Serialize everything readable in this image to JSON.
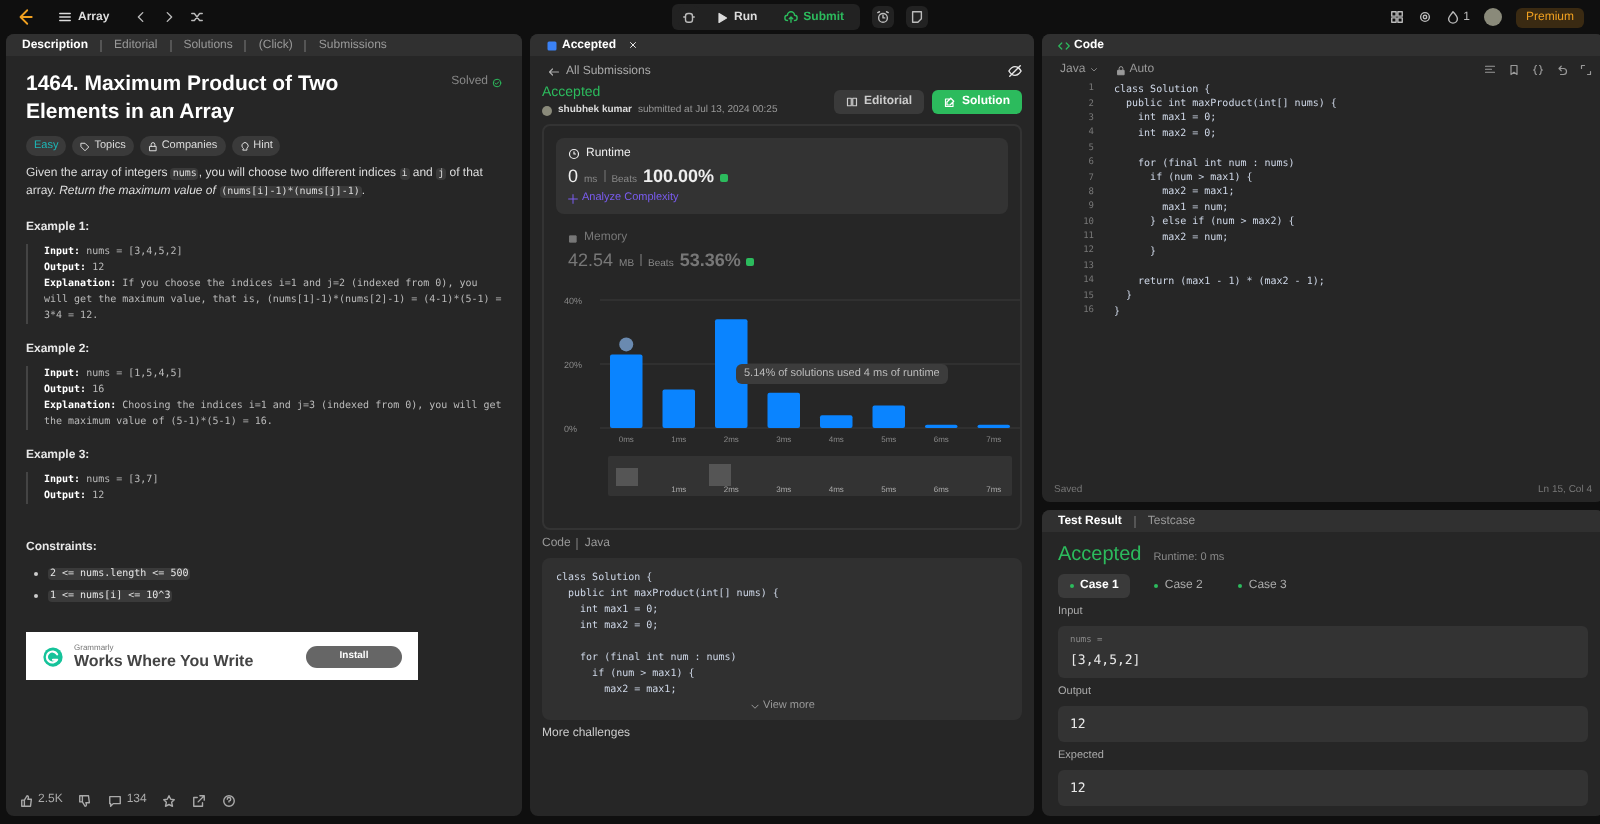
{
  "top_bar": {
    "list_label": "Array",
    "run": "Run",
    "submit": "Submit",
    "streak": "1",
    "premium": "Premium"
  },
  "description_panel": {
    "tabs": [
      {
        "label": "Description",
        "selected": true
      },
      {
        "label": "Editorial",
        "selected": false
      },
      {
        "label": "Solutions",
        "selected": false
      },
      {
        "label": "(Click)",
        "selected": false
      },
      {
        "label": "Submissions",
        "selected": false
      }
    ],
    "title": "1464. Maximum Product of Two Elements in an Array",
    "solved": "Solved",
    "tags": [
      {
        "kind": "difficulty",
        "label": "Easy"
      },
      {
        "kind": "topics",
        "label": "Topics"
      },
      {
        "kind": "companies",
        "label": "Companies"
      },
      {
        "kind": "hint",
        "label": "Hint"
      }
    ],
    "statement": [
      {
        "kind": "text",
        "text": "Given the array of integers "
      },
      {
        "kind": "code",
        "text": "nums"
      },
      {
        "kind": "text",
        "text": ", you will choose two different indices "
      },
      {
        "kind": "code",
        "text": "i"
      },
      {
        "kind": "text",
        "text": " and "
      },
      {
        "kind": "code",
        "text": "j"
      },
      {
        "kind": "text",
        "text": " of that array. "
      },
      {
        "kind": "italic",
        "text": "Return the maximum value of "
      },
      {
        "kind": "code",
        "text": "(nums[i]-1)*(nums[j]-1)"
      },
      {
        "kind": "text",
        "text": "."
      }
    ],
    "examples": [
      {
        "title": "Example 1:",
        "lines": [
          {
            "label": "Input:",
            "text": "nums = [3,4,5,2]"
          },
          {
            "label": "Output:",
            "text": "12"
          },
          {
            "label": "Explanation:",
            "text": "If you choose the indices i=1 and j=2 (indexed from 0), you will get the maximum value, that is, (nums[1]-1)*(nums[2]-1) = (4-1)*(5-1) = 3*4 = 12."
          }
        ]
      },
      {
        "title": "Example 2:",
        "lines": [
          {
            "label": "Input:",
            "text": "nums = [1,5,4,5]"
          },
          {
            "label": "Output:",
            "text": "16"
          },
          {
            "label": "Explanation:",
            "text": "Choosing the indices i=1 and j=3 (indexed from 0), you will get the maximum value of (5-1)*(5-1) = 16."
          }
        ]
      },
      {
        "title": "Example 3:",
        "lines": [
          {
            "label": "Input:",
            "text": "nums = [3,7]"
          },
          {
            "label": "Output:",
            "text": "12"
          }
        ]
      }
    ],
    "constraints_title": "Constraints:",
    "constraints": [
      "2 <= nums.length <= 500",
      "1 <= nums[i] <= 10^3"
    ],
    "ad": {
      "brand": "Grammarly",
      "headline": "Works Where You Write",
      "button": "Install"
    },
    "footer": {
      "likes": "2.5K",
      "comments": "134"
    }
  },
  "submission_panel": {
    "tab": "Accepted",
    "back": "All Submissions",
    "status": "Accepted",
    "user": "shubhek kumar",
    "submitted": "submitted at Jul 13, 2024 00:25",
    "editorial": "Editorial",
    "solution": "Solution",
    "metrics": [
      {
        "kind": "runtime",
        "label": "Runtime",
        "value": "0",
        "unit": "ms",
        "beats_label": "Beats",
        "beats": "100.00%",
        "selected": true,
        "link": "Analyze Complexity"
      },
      {
        "kind": "memory",
        "label": "Memory",
        "value": "42.54",
        "unit": "MB",
        "beats_label": "Beats",
        "beats": "53.36%",
        "selected": false
      }
    ],
    "chart_data": {
      "type": "bar",
      "categories": [
        "0ms",
        "1ms",
        "2ms",
        "3ms",
        "4ms",
        "5ms",
        "6ms",
        "7ms"
      ],
      "values": [
        23,
        12,
        34,
        11,
        4,
        7,
        1,
        1
      ],
      "ylim": [
        0,
        40
      ],
      "yticks": [
        {
          "value": 0,
          "label": "0%"
        },
        {
          "value": 20,
          "label": "20%"
        },
        {
          "value": 40,
          "label": "40%"
        }
      ]
    },
    "tooltip": "5.14% of solutions used 4 ms of runtime",
    "navigator_labels": [
      "1ms",
      "2ms",
      "3ms",
      "4ms",
      "5ms",
      "6ms",
      "7ms"
    ],
    "code_label": "Code",
    "code_lang": "Java",
    "code": [
      {
        "kind": "code",
        "code": "class Solution {"
      },
      {
        "kind": "code",
        "code": "  public int maxProduct(int[] nums) {"
      },
      {
        "kind": "code",
        "code": "    int max1 = 0;"
      },
      {
        "kind": "code",
        "code": "    int max2 = 0;"
      },
      {
        "kind": "blank"
      },
      {
        "kind": "code",
        "code": "    for (final int num : nums)"
      },
      {
        "kind": "code",
        "code": "      if (num > max1) {"
      },
      {
        "kind": "code",
        "code": "        max2 = max1;"
      }
    ],
    "view_more": "View more",
    "more": "More challenges"
  },
  "editor": {
    "tab": "Code",
    "language": "Java",
    "mode": "Auto",
    "lines": [
      {
        "n": "1",
        "code": "class Solution {"
      },
      {
        "n": "2",
        "code": "  public int maxProduct(int[] nums) {"
      },
      {
        "n": "3",
        "code": "    int max1 = 0;"
      },
      {
        "n": "4",
        "code": "    int max2 = 0;"
      },
      {
        "n": "5"
      },
      {
        "n": "6",
        "code": "    for (final int num : nums)"
      },
      {
        "n": "7",
        "code": "      if (num > max1) {"
      },
      {
        "n": "8",
        "code": "        max2 = max1;"
      },
      {
        "n": "9",
        "code": "        max1 = num;"
      },
      {
        "n": "10",
        "code": "      } else if (num > max2) {"
      },
      {
        "n": "11",
        "code": "        max2 = num;"
      },
      {
        "n": "12",
        "code": "      }"
      },
      {
        "n": "13"
      },
      {
        "n": "14",
        "code": "    return (max1 - 1) * (max2 - 1);"
      },
      {
        "n": "15",
        "code": "  }"
      },
      {
        "n": "16",
        "code": "}"
      }
    ],
    "saved": "Saved",
    "position": "Ln 15, Col 4"
  },
  "test_panel": {
    "tabs": [
      {
        "label": "Test Result",
        "selected": true
      },
      {
        "label": "Testcase",
        "selected": false
      }
    ],
    "status": "Accepted",
    "runtime": "Runtime: 0 ms",
    "cases": [
      {
        "label": "Case 1",
        "selected": true
      },
      {
        "label": "Case 2",
        "selected": false
      },
      {
        "label": "Case 3",
        "selected": false
      }
    ],
    "input_label": "Input",
    "var": "nums =",
    "input": "[3,4,5,2]",
    "output_label": "Output",
    "output": "12",
    "expected_label": "Expected",
    "expected": "12"
  }
}
